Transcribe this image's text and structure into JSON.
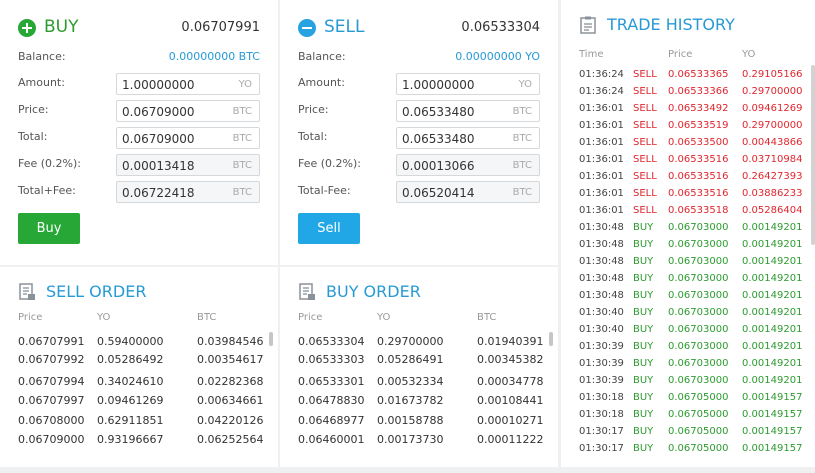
{
  "buy": {
    "title": "BUY",
    "price": "0.06707991",
    "balance_label": "Balance:",
    "balance_value": "0.00000000 BTC",
    "fields": [
      {
        "label": "Amount:",
        "value": "1.00000000",
        "unit": "YO"
      },
      {
        "label": "Price:",
        "value": "0.06709000",
        "unit": "BTC"
      },
      {
        "label": "Total:",
        "value": "0.06709000",
        "unit": "BTC"
      },
      {
        "label": "Fee (0.2%):",
        "value": "0.00013418",
        "unit": "BTC"
      },
      {
        "label": "Total+Fee:",
        "value": "0.06722418",
        "unit": "BTC"
      }
    ],
    "button": "Buy"
  },
  "sell": {
    "title": "SELL",
    "price": "0.06533304",
    "balance_label": "Balance:",
    "balance_value": "0.00000000 YO",
    "fields": [
      {
        "label": "Amount:",
        "value": "1.00000000",
        "unit": "YO"
      },
      {
        "label": "Price:",
        "value": "0.06533480",
        "unit": "BTC"
      },
      {
        "label": "Total:",
        "value": "0.06533480",
        "unit": "BTC"
      },
      {
        "label": "Fee (0.2%):",
        "value": "0.00013066",
        "unit": "BTC"
      },
      {
        "label": "Total-Fee:",
        "value": "0.06520414",
        "unit": "BTC"
      }
    ],
    "button": "Sell"
  },
  "sell_order": {
    "title": "SELL ORDER",
    "columns": [
      "Price",
      "YO",
      "BTC"
    ],
    "rows": [
      [
        "0.06707991",
        "0.59400000",
        "0.03984546"
      ],
      [
        "0.06707992",
        "0.05286492",
        "0.00354617"
      ],
      [
        "0.06707994",
        "0.34024610",
        "0.02282368"
      ],
      [
        "0.06707997",
        "0.09461269",
        "0.00634661"
      ],
      [
        "0.06708000",
        "0.62911851",
        "0.04220126"
      ],
      [
        "0.06709000",
        "0.93196667",
        "0.06252564"
      ]
    ]
  },
  "buy_order": {
    "title": "BUY ORDER",
    "columns": [
      "Price",
      "YO",
      "BTC"
    ],
    "rows": [
      [
        "0.06533304",
        "0.29700000",
        "0.01940391"
      ],
      [
        "0.06533303",
        "0.05286491",
        "0.00345382"
      ],
      [
        "0.06533301",
        "0.00532334",
        "0.00034778"
      ],
      [
        "0.06478830",
        "0.01673782",
        "0.00108441"
      ],
      [
        "0.06468977",
        "0.00158788",
        "0.00010271"
      ],
      [
        "0.06460001",
        "0.00173730",
        "0.00011222"
      ]
    ]
  },
  "trade_history": {
    "title": "TRADE HISTORY",
    "columns": [
      "Time",
      "Price",
      "YO"
    ],
    "rows": [
      [
        "01:36:24",
        "SELL",
        "0.06533365",
        "0.29105166"
      ],
      [
        "01:36:24",
        "SELL",
        "0.06533366",
        "0.29700000"
      ],
      [
        "01:36:01",
        "SELL",
        "0.06533492",
        "0.09461269"
      ],
      [
        "01:36:01",
        "SELL",
        "0.06533519",
        "0.29700000"
      ],
      [
        "01:36:01",
        "SELL",
        "0.06533500",
        "0.00443866"
      ],
      [
        "01:36:01",
        "SELL",
        "0.06533516",
        "0.03710984"
      ],
      [
        "01:36:01",
        "SELL",
        "0.06533516",
        "0.26427393"
      ],
      [
        "01:36:01",
        "SELL",
        "0.06533516",
        "0.03886233"
      ],
      [
        "01:36:01",
        "SELL",
        "0.06533518",
        "0.05286404"
      ],
      [
        "01:30:48",
        "BUY",
        "0.06703000",
        "0.00149201"
      ],
      [
        "01:30:48",
        "BUY",
        "0.06703000",
        "0.00149201"
      ],
      [
        "01:30:48",
        "BUY",
        "0.06703000",
        "0.00149201"
      ],
      [
        "01:30:48",
        "BUY",
        "0.06703000",
        "0.00149201"
      ],
      [
        "01:30:48",
        "BUY",
        "0.06703000",
        "0.00149201"
      ],
      [
        "01:30:40",
        "BUY",
        "0.06703000",
        "0.00149201"
      ],
      [
        "01:30:40",
        "BUY",
        "0.06703000",
        "0.00149201"
      ],
      [
        "01:30:39",
        "BUY",
        "0.06703000",
        "0.00149201"
      ],
      [
        "01:30:39",
        "BUY",
        "0.06703000",
        "0.00149201"
      ],
      [
        "01:30:39",
        "BUY",
        "0.06703000",
        "0.00149201"
      ],
      [
        "01:30:18",
        "BUY",
        "0.06705000",
        "0.00149157"
      ],
      [
        "01:30:18",
        "BUY",
        "0.06705000",
        "0.00149157"
      ],
      [
        "01:30:17",
        "BUY",
        "0.06705000",
        "0.00149157"
      ],
      [
        "01:30:17",
        "BUY",
        "0.06705000",
        "0.00149157"
      ]
    ]
  },
  "colors": {
    "buy_green": "#27a836",
    "sell_blue": "#22a7e6",
    "sell_red": "#e0262e",
    "title_blue": "#279ad6"
  },
  "icons": {
    "buy": "plus-circle-icon",
    "sell": "minus-circle-icon",
    "order": "document-icon",
    "history": "clipboard-icon"
  }
}
